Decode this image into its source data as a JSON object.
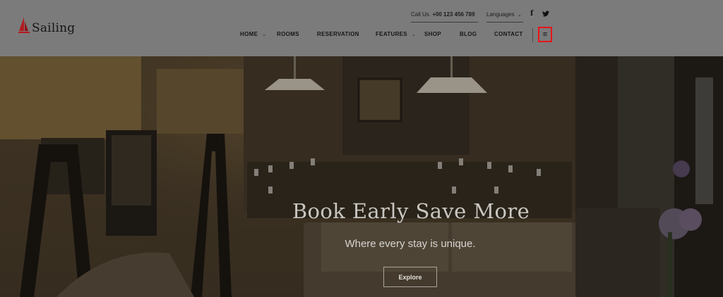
{
  "logo": {
    "text": "Sailing",
    "icon": "sail-icon",
    "accent_color": "#b51a1f"
  },
  "topbar": {
    "call_label": "Call Us.",
    "phone": "+00 123 456 789",
    "languages_label": "Languages",
    "languages_caret": "⌄",
    "social": {
      "facebook": "f",
      "twitter": "🐦"
    }
  },
  "nav": {
    "items": [
      {
        "label": "HOME",
        "dropdown": true
      },
      {
        "label": "ROOMS",
        "dropdown": false
      },
      {
        "label": "RESERVATION",
        "dropdown": false
      },
      {
        "label": "FEATURES",
        "dropdown": true
      },
      {
        "label": "SHOP",
        "dropdown": false
      },
      {
        "label": "BLOG",
        "dropdown": false
      },
      {
        "label": "CONTACT",
        "dropdown": false
      }
    ],
    "dropdown_caret": "⌄",
    "menu_icon": "≡",
    "menu_highlight_color": "#e8141a"
  },
  "hero": {
    "title": "Book Early Save More",
    "subtitle": "Where every stay is unique.",
    "button_label": "Explore"
  }
}
